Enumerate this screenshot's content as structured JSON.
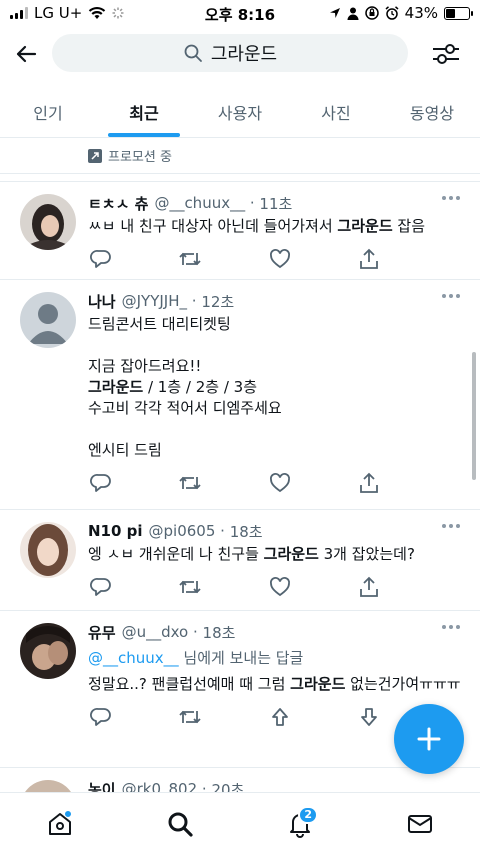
{
  "status_bar": {
    "carrier": "LG U+",
    "time": "오후 8:16",
    "battery": "43%",
    "battery_level": 0.43
  },
  "search": {
    "query": "그라운드"
  },
  "tabs": [
    {
      "label": "인기"
    },
    {
      "label": "최근",
      "active": true
    },
    {
      "label": "사용자"
    },
    {
      "label": "사진"
    },
    {
      "label": "동영상"
    }
  ],
  "promo": {
    "label": "프로모션 중"
  },
  "tweets": [
    {
      "name": "ㅌㅊㅅ 츄",
      "handle": "@__chuux__",
      "time": "11초",
      "reply_to": "",
      "reply_suffix": "",
      "segments": [
        "ㅆㅂ 내 친구 대상자 아닌데 들어가져서 ",
        "그라운드",
        " 잡음"
      ]
    },
    {
      "name": "나나",
      "handle": "@JYYJJH_",
      "time": "12초",
      "reply_to": "",
      "reply_suffix": "",
      "segments": [
        "드림콘서트 대리티켓팅\n\n지금 잡아드려요!!\n",
        "그라운드",
        " / 1층 / 2층 / 3층\n수고비 각각 적어서 디엠주세요\n\n엔시티 드림"
      ]
    },
    {
      "name": "N10 pi",
      "handle": "@pi0605",
      "time": "18초",
      "reply_to": "",
      "reply_suffix": "",
      "segments": [
        "엥 ㅅㅂ 개쉬운데 나 친구들 ",
        "그라운드",
        " 3개 잡았는데?"
      ]
    },
    {
      "name": "유무",
      "handle": "@u__dxo",
      "time": "18초",
      "reply_to": "@__chuux__",
      "reply_suffix": " 님에게 보내는 답글",
      "segments": [
        "정말요..? 팬클럽선예매 때 그럼 ",
        "그라운드",
        " 없는건가여ㅠㅠㅠ"
      ]
    },
    {
      "name": "농이",
      "handle": "@rk0_802",
      "time": "20초",
      "reply_to": "",
      "reply_suffix": "",
      "segments": [
        "",
        "",
        ""
      ]
    }
  ],
  "nav": {
    "notifications_badge": "2"
  },
  "colors": {
    "accent": "#1d9bf0",
    "text": "#0f1419",
    "muted": "#536471"
  }
}
